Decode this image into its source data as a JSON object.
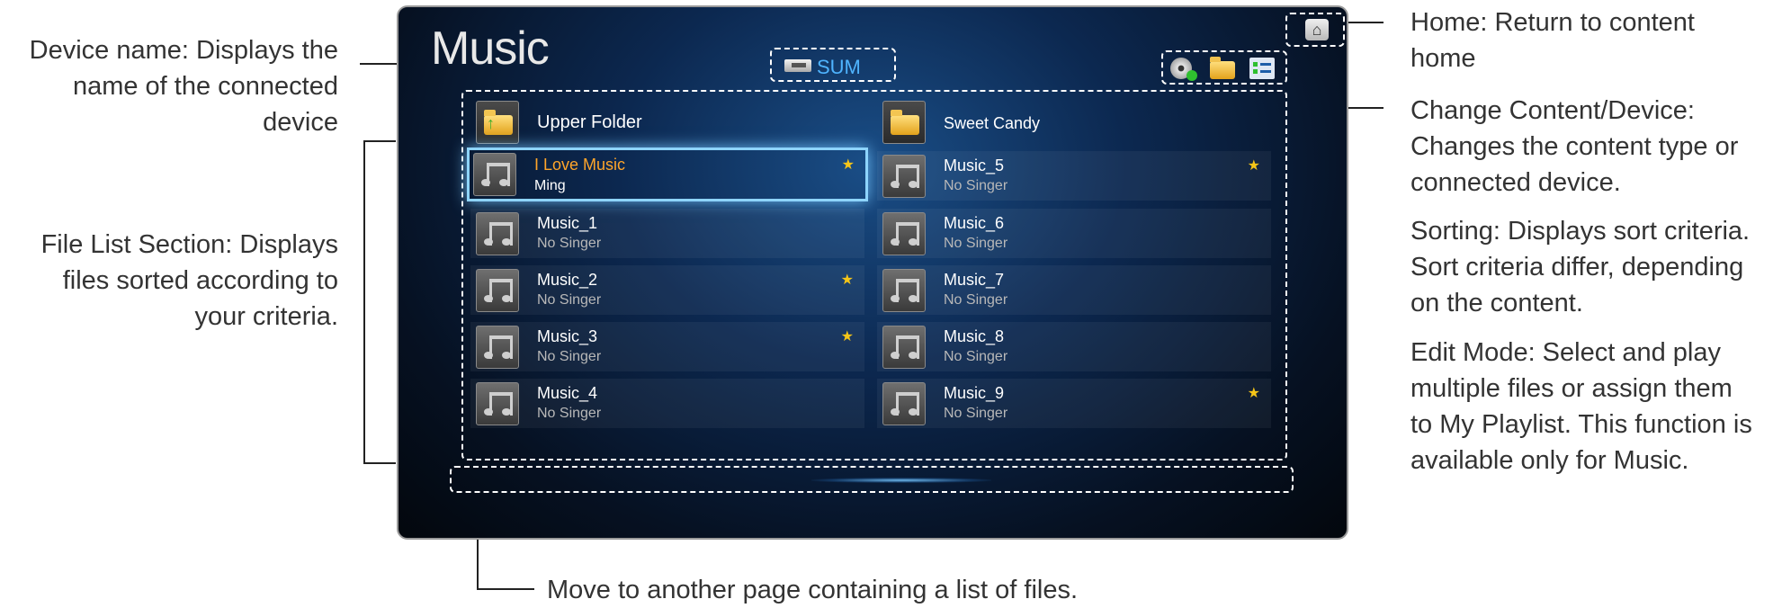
{
  "callouts": {
    "device_name": [
      "Device name: Displays the",
      "name of the connected",
      "device"
    ],
    "file_list": [
      "File List Section: Displays",
      "files sorted according to",
      "your criteria."
    ],
    "home": [
      "Home: Return to content",
      "home"
    ],
    "change_content": [
      "Change Content/Device:",
      "Changes the content type or",
      "connected device."
    ],
    "sorting": [
      "Sorting: Displays sort criteria.",
      "Sort criteria differ, depending",
      "on the content."
    ],
    "edit_mode": [
      "Edit Mode: Select and play",
      "multiple files or assign them",
      "to My Playlist. This function is",
      "available only for Music."
    ],
    "pager": "Move to another page containing a list of files."
  },
  "screen": {
    "title": "Music",
    "device_label": "SUM",
    "colors": {
      "accent_blue": "#4fb4ff",
      "selected_text": "#ffa52a",
      "star": "#f5c518"
    }
  },
  "file_list": {
    "left": [
      {
        "title": "Upper Folder",
        "subtitle": "",
        "type": "upper-folder"
      },
      {
        "title": "I Love Music",
        "subtitle": "Ming",
        "type": "music",
        "starred": true,
        "selected": true
      },
      {
        "title": "Music_1",
        "subtitle": "No Singer",
        "type": "music"
      },
      {
        "title": "Music_2",
        "subtitle": "No Singer",
        "type": "music",
        "starred": true
      },
      {
        "title": "Music_3",
        "subtitle": "No Singer",
        "type": "music",
        "starred": true
      },
      {
        "title": "Music_4",
        "subtitle": "No Singer",
        "type": "music"
      }
    ],
    "right": [
      {
        "title": "Sweet Candy",
        "subtitle": "",
        "type": "folder"
      },
      {
        "title": "Music_5",
        "subtitle": "No Singer",
        "type": "music",
        "starred": true
      },
      {
        "title": "Music_6",
        "subtitle": "No Singer",
        "type": "music"
      },
      {
        "title": "Music_7",
        "subtitle": "No Singer",
        "type": "music"
      },
      {
        "title": "Music_8",
        "subtitle": "No Singer",
        "type": "music"
      },
      {
        "title": "Music_9",
        "subtitle": "No Singer",
        "type": "music",
        "starred": true
      }
    ],
    "star_glyph": "★"
  },
  "icons": {
    "home": "home-icon",
    "device": "usb-device-icon",
    "change_content": "disc-icon",
    "sorting": "folder-icon",
    "edit_mode": "edit-list-icon",
    "music": "music-note-icon",
    "folder": "folder-icon",
    "upper_folder": "upper-folder-icon"
  }
}
